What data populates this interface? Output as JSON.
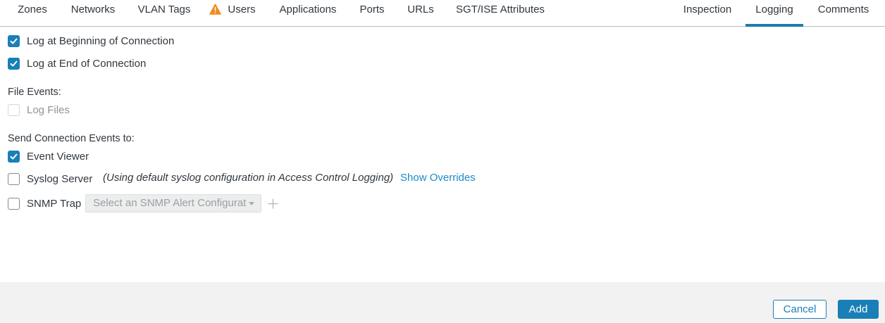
{
  "tabs": [
    {
      "label": "Zones"
    },
    {
      "label": "Networks"
    },
    {
      "label": "VLAN Tags"
    },
    {
      "label": "Users",
      "icon": "warning-icon"
    },
    {
      "label": "Applications"
    },
    {
      "label": "Ports"
    },
    {
      "label": "URLs"
    },
    {
      "label": "SGT/ISE Attributes"
    },
    {
      "label": "Inspection"
    },
    {
      "label": "Logging",
      "active": true
    },
    {
      "label": "Comments"
    }
  ],
  "logging": {
    "log_beginning": {
      "label": "Log at Beginning of Connection",
      "checked": true
    },
    "log_end": {
      "label": "Log at End of Connection",
      "checked": true
    },
    "file_events_label": "File Events:",
    "log_files": {
      "label": "Log Files",
      "checked": false,
      "disabled": true
    },
    "send_events_label": "Send Connection Events to:",
    "event_viewer": {
      "label": "Event Viewer",
      "checked": true
    },
    "syslog_server": {
      "label": "Syslog Server",
      "checked": false
    },
    "syslog_note": "(Using default syslog configuration in Access Control Logging)",
    "show_overrides_link": "Show Overrides",
    "snmp_trap": {
      "label": "SNMP Trap",
      "checked": false
    },
    "snmp_select_placeholder": "Select an SNMP Alert Configurat"
  },
  "footer": {
    "cancel_label": "Cancel",
    "add_label": "Add"
  },
  "colors": {
    "accent": "#1b7fb7",
    "link": "#1c8bc8",
    "warning": "#f28a1c",
    "footer_bg": "#f2f2f2"
  }
}
